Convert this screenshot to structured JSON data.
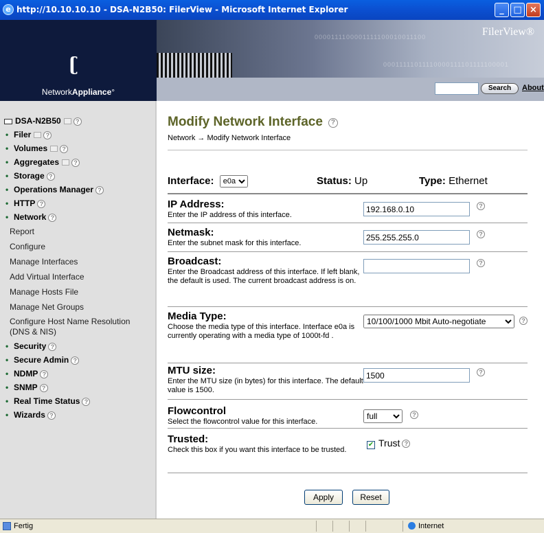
{
  "window": {
    "title": "http://10.10.10.10 - DSA-N2B50: FilerView - Microsoft Internet Explorer"
  },
  "header": {
    "logo_prefix": "Network",
    "logo_bold": "Appliance",
    "logo_tm": "°",
    "product": "FilerView®",
    "search_value": "",
    "search_button": "Search",
    "about_link": "About",
    "binary_1": "0000111100001111100010011100",
    "binary_2": "00011111011110000111101111100001"
  },
  "sidebar": {
    "server": "DSA-N2B50",
    "items": [
      {
        "label": "Filer",
        "win": true
      },
      {
        "label": "Volumes",
        "win": true
      },
      {
        "label": "Aggregates",
        "win": true
      },
      {
        "label": "Storage",
        "win": false
      },
      {
        "label": "Operations Manager",
        "win": false
      },
      {
        "label": "HTTP",
        "win": false
      },
      {
        "label": "Network",
        "win": false
      }
    ],
    "network_sub": [
      "Report",
      "Configure",
      "Manage Interfaces",
      "Add Virtual Interface",
      "Manage Hosts File",
      "Manage Net Groups",
      "Configure Host Name Resolution (DNS & NIS)"
    ],
    "items_after": [
      "Security",
      "Secure Admin",
      "NDMP",
      "SNMP",
      "Real Time Status",
      "Wizards"
    ]
  },
  "main": {
    "title": "Modify Network Interface",
    "breadcrumb": "Network → Modify Network Interface",
    "interface_label": "Interface:",
    "interface_value": "e0a",
    "status_label": "Status:",
    "status_value": "Up",
    "type_label": "Type:",
    "type_value": "Ethernet",
    "fields": {
      "ip": {
        "title": "IP Address:",
        "desc": "Enter the IP address of this interface.",
        "value": "192.168.0.10"
      },
      "netmask": {
        "title": "Netmask:",
        "desc": "Enter the subnet mask for this interface.",
        "value": "255.255.255.0"
      },
      "broadcast": {
        "title": "Broadcast:",
        "desc": "Enter the Broadcast address of this interface. If left blank, the default is used. The current broadcast address is on.",
        "value": ""
      },
      "media": {
        "title": "Media Type:",
        "desc": "Choose the media type of this interface. Interface e0a is currently operating with a media type of 1000t-fd .",
        "value": "10/100/1000 Mbit Auto-negotiate"
      },
      "mtu": {
        "title": "MTU size:",
        "desc": "Enter the MTU size (in bytes) for this interface. The default value is 1500.",
        "value": "1500"
      },
      "flow": {
        "title": "Flowcontrol",
        "desc": "Select the flowcontrol value for this interface.",
        "value": "full"
      },
      "trusted": {
        "title": "Trusted:",
        "desc": "Check this box if you want this interface to be trusted.",
        "checkbox_label": "Trust",
        "checked": true
      }
    },
    "apply_button": "Apply",
    "reset_button": "Reset"
  },
  "statusbar": {
    "status": "Fertig",
    "zone": "Internet"
  },
  "colors": {
    "title_green": "#5d6428",
    "sidebar_bg": "#e0e0e0",
    "titlebar_blue": "#0b4fd0"
  }
}
